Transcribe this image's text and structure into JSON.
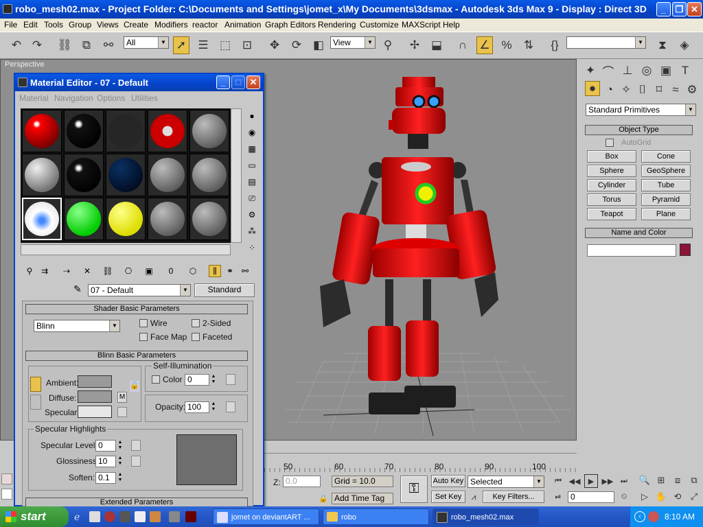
{
  "window": {
    "title": "robo_mesh02.max    - Project Folder: C:\\Documents and Settings\\jomet_x\\My Documents\\3dsmax     - Autodesk 3ds Max 9      - Display : Direct 3D"
  },
  "menu": [
    "File",
    "Edit",
    "Tools",
    "Group",
    "Views",
    "Create",
    "Modifiers",
    "reactor",
    "Animation",
    "Graph Editors",
    "Rendering",
    "Customize",
    "MAXScript",
    "Help"
  ],
  "toolbar": {
    "selection_filter": "All",
    "ref_coord": "View",
    "named_sel": ""
  },
  "viewport": {
    "label": "Perspective"
  },
  "material_editor": {
    "title": "Material Editor - 07 - Default",
    "menu": [
      "Material",
      "Navigation",
      "Options",
      "Utilities"
    ],
    "material_name": "07 - Default",
    "material_type": "Standard",
    "shader_rollout": "Shader Basic Parameters",
    "shader": "Blinn",
    "wire": "Wire",
    "two_sided": "2-Sided",
    "face_map": "Face Map",
    "faceted": "Faceted",
    "blinn_rollout": "Blinn Basic Parameters",
    "ambient": "Ambient:",
    "diffuse": "Diffuse:",
    "specular": "Specular:",
    "self_illum": "Self-Illumination",
    "color": "Color",
    "color_val": "0",
    "opacity": "Opacity:",
    "opacity_val": "100",
    "spec_highlights": "Specular Highlights",
    "spec_level": "Specular Level:",
    "spec_level_val": "0",
    "glossiness": "Glossiness:",
    "glossiness_val": "10",
    "soften": "Soften:",
    "soften_val": "0.1",
    "extended": "Extended Parameters",
    "map_button": "M"
  },
  "command_panel": {
    "category": "Standard Primitives",
    "object_type": "Object Type",
    "autogrid": "AutoGrid",
    "buttons": [
      "Box",
      "Cone",
      "Sphere",
      "GeoSphere",
      "Cylinder",
      "Tube",
      "Torus",
      "Pyramid",
      "Teapot",
      "Plane"
    ],
    "name_color": "Name and Color",
    "object_name": "",
    "color": "#8b1538"
  },
  "timeline": {
    "ticks": [
      "50",
      "60",
      "70",
      "80",
      "90",
      "100"
    ]
  },
  "status": {
    "z_label": "Z:",
    "z_val": "0.0",
    "grid": "Grid = 10.0",
    "add_time_tag": "Add Time Tag",
    "auto_key": "Auto Key",
    "set_key": "Set Key",
    "key_mode": "Selected",
    "key_filters": "Key Filters...",
    "frame": "0"
  },
  "taskbar": {
    "start": "start",
    "tasks": [
      "jomet on deviantART ...",
      "robo",
      "robo_mesh02.max"
    ],
    "time": "8:10 AM"
  }
}
